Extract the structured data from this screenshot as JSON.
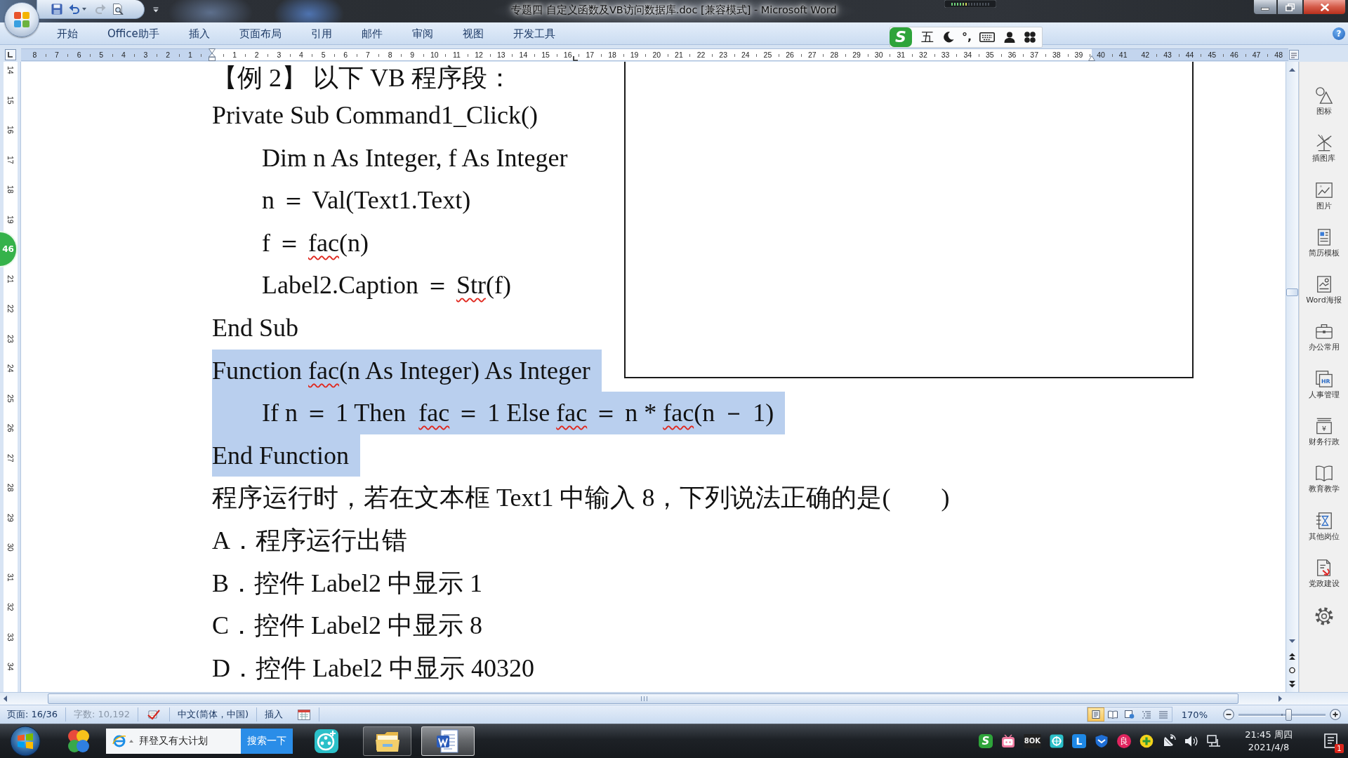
{
  "title_bar": {
    "title": "专题四 自定义函数及VB访问数据库.doc [兼容模式] - Microsoft Word"
  },
  "menu": {
    "tabs": [
      {
        "label": "开始",
        "selected": false
      },
      {
        "label": "Office助手",
        "selected": false
      },
      {
        "label": "插入",
        "selected": false
      },
      {
        "label": "页面布局",
        "selected": false
      },
      {
        "label": "引用",
        "selected": false
      },
      {
        "label": "邮件",
        "selected": false
      },
      {
        "label": "审阅",
        "selected": false
      },
      {
        "label": "视图",
        "selected": false
      },
      {
        "label": "开发工具",
        "selected": false
      }
    ],
    "help_glyph": "?"
  },
  "ime_toolbar": {
    "logo_glyph": "S",
    "mode": "五",
    "punctuation": "°,"
  },
  "ruler": {
    "left_labels": [
      "8",
      "7",
      "6",
      "5",
      "4",
      "3",
      "2",
      "1"
    ],
    "right_labels": [
      "1",
      "2",
      "3",
      "4",
      "5",
      "6",
      "7",
      "8",
      "9",
      "10",
      "11",
      "12",
      "13",
      "14",
      "15",
      "16",
      "17",
      "18",
      "19",
      "20",
      "21",
      "22",
      "23",
      "24",
      "25",
      "26",
      "27",
      "28",
      "29",
      "30",
      "31",
      "32",
      "33",
      "34",
      "35",
      "36",
      "37",
      "38",
      "39",
      "40",
      "41",
      "42",
      "43",
      "44",
      "45",
      "46",
      "47",
      "48"
    ]
  },
  "vertical_ruler": {
    "upper_labels": [
      "14",
      "15",
      "16",
      "17",
      "18",
      "19"
    ],
    "lower_labels": [
      "21",
      "22",
      "23",
      "24",
      "25",
      "26",
      "27",
      "28",
      "29",
      "30",
      "31",
      "32",
      "33",
      "34"
    ]
  },
  "floating_badge": {
    "text": "46"
  },
  "document": {
    "upper_lines": [
      {
        "kind": "plain",
        "selected": false,
        "segments": [
          {
            "text": "【例 2】 以下 VB 程序段：",
            "misspelled": false
          }
        ]
      },
      {
        "kind": "plain",
        "selected": false,
        "segments": [
          {
            "text": "Private Sub Command1_Click()",
            "misspelled": false
          }
        ]
      },
      {
        "kind": "indented",
        "selected": false,
        "segments": [
          {
            "text": "Dim n As Integer, f As Integer",
            "misspelled": false
          }
        ]
      },
      {
        "kind": "indented",
        "selected": false,
        "segments": [
          {
            "text": "n ＝ Val(Text1.Text)",
            "misspelled": false
          }
        ]
      },
      {
        "kind": "indented",
        "selected": false,
        "segments": [
          {
            "text": "f ＝ ",
            "misspelled": false
          },
          {
            "text": "fac",
            "misspelled": true
          },
          {
            "text": "(n)",
            "misspelled": false
          }
        ]
      },
      {
        "kind": "indented",
        "selected": false,
        "segments": [
          {
            "text": "Label2.Caption ＝ ",
            "misspelled": false
          },
          {
            "text": "Str",
            "misspelled": true
          },
          {
            "text": "(f)",
            "misspelled": false
          }
        ]
      },
      {
        "kind": "plain",
        "selected": false,
        "segments": [
          {
            "text": "End Sub",
            "misspelled": false
          }
        ]
      },
      {
        "kind": "plain",
        "selected": true,
        "segments": [
          {
            "text": "Function ",
            "misspelled": false
          },
          {
            "text": "fac",
            "misspelled": true
          },
          {
            "text": "(n As Integer) As Integer",
            "misspelled": false
          }
        ]
      }
    ],
    "lower_lines": [
      {
        "kind": "indented",
        "selected": true,
        "segments": [
          {
            "text": "If n ＝ 1 Then  ",
            "misspelled": false
          },
          {
            "text": "fac",
            "misspelled": true
          },
          {
            "text": " ＝ 1 Else ",
            "misspelled": false
          },
          {
            "text": "fac",
            "misspelled": true
          },
          {
            "text": " ＝ n * ",
            "misspelled": false
          },
          {
            "text": "fac",
            "misspelled": true
          },
          {
            "text": "(n － 1)",
            "misspelled": false
          }
        ]
      },
      {
        "kind": "plain",
        "selected": true,
        "segments": [
          {
            "text": "End Function",
            "misspelled": false
          }
        ]
      },
      {
        "kind": "plain",
        "selected": false,
        "segments": [
          {
            "text": "程序运行时，若在文本框 Text1 中输入 8，下列说法正确的是(　　)",
            "misspelled": false
          }
        ]
      },
      {
        "kind": "plain",
        "selected": false,
        "segments": [
          {
            "text": "A．程序运行出错",
            "misspelled": false
          }
        ]
      },
      {
        "kind": "plain",
        "selected": false,
        "segments": [
          {
            "text": "B．控件 Label2 中显示 1",
            "misspelled": false
          }
        ]
      },
      {
        "kind": "plain",
        "selected": false,
        "segments": [
          {
            "text": "C．控件 Label2 中显示 8",
            "misspelled": false
          }
        ]
      },
      {
        "kind": "plain",
        "selected": false,
        "segments": [
          {
            "text": "D．控件 Label2 中显示 40320",
            "misspelled": false
          }
        ]
      }
    ]
  },
  "sidebar": {
    "items": [
      {
        "label": "图标",
        "kind": "shapes"
      },
      {
        "label": "插图库",
        "kind": "pinwheel"
      },
      {
        "label": "图片",
        "kind": "picture"
      },
      {
        "label": "简历模板",
        "kind": "resume"
      },
      {
        "label": "Word海报",
        "kind": "poster"
      },
      {
        "label": "办公常用",
        "kind": "briefcase"
      },
      {
        "label": "人事管理",
        "kind": "hr",
        "glyph": "HR"
      },
      {
        "label": "财务行政",
        "kind": "finance",
        "glyph": "¥"
      },
      {
        "label": "教育教学",
        "kind": "book"
      },
      {
        "label": "其他岗位",
        "kind": "hourglass"
      },
      {
        "label": "党政建设",
        "kind": "party"
      }
    ]
  },
  "status_bar": {
    "page": "页面: 16/36",
    "word_count": "字数: 10,192",
    "language": "中文(简体，中国)",
    "mode": "插入",
    "view_buttons": [
      {
        "kind": "print-layout",
        "selected": true
      },
      {
        "kind": "reading",
        "selected": false
      },
      {
        "kind": "web-layout",
        "selected": false
      },
      {
        "kind": "outline",
        "selected": false
      },
      {
        "kind": "draft",
        "selected": false
      }
    ],
    "zoom": "170%",
    "zoom_slider": {
      "level": 0.58
    }
  },
  "taskbar": {
    "left_apps": [
      {
        "kind": "petals",
        "running": false,
        "selected": false
      }
    ],
    "search": {
      "value": "拜登又有大计划",
      "button": "搜索一下"
    },
    "apps": [
      {
        "kind": "reel",
        "running": false,
        "selected": false
      },
      {
        "kind": "explorer",
        "running": true,
        "selected": false
      },
      {
        "kind": "word",
        "running": true,
        "selected": true
      }
    ],
    "tray": [
      {
        "kind": "input-method",
        "glyph": "S"
      },
      {
        "kind": "tv"
      },
      {
        "kind": "text-logo",
        "glyph": "8OK"
      },
      {
        "kind": "ring-tile"
      },
      {
        "kind": "letter-tile",
        "glyph": "L"
      },
      {
        "kind": "shield"
      },
      {
        "kind": "red-disc",
        "glyph": "良"
      },
      {
        "kind": "plus-disc"
      },
      {
        "kind": "satellite"
      },
      {
        "kind": "volume"
      },
      {
        "kind": "network"
      }
    ],
    "time": "21:45 周四",
    "date": "2021/4/8",
    "notification_count": "1"
  }
}
